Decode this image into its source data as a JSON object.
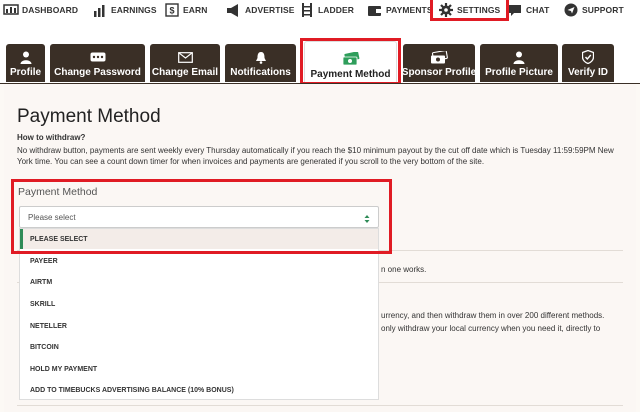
{
  "topnav": {
    "items": [
      {
        "label": "DASHBOARD",
        "icon": "dashboard-icon"
      },
      {
        "label": "EARNINGS",
        "icon": "bar-chart-icon"
      },
      {
        "label": "EARN",
        "icon": "dollar-icon"
      },
      {
        "label": "ADVERTISE",
        "icon": "megaphone-icon"
      },
      {
        "label": "LADDER",
        "icon": "ladder-icon"
      },
      {
        "label": "PAYMENTS",
        "icon": "wallet-icon"
      },
      {
        "label": "SETTINGS",
        "icon": "gear-icon"
      },
      {
        "label": "CHAT",
        "icon": "chat-icon"
      },
      {
        "label": "SUPPORT",
        "icon": "send-icon"
      }
    ]
  },
  "tabs": [
    {
      "label": "Profile",
      "icon": "user-icon"
    },
    {
      "label": "Change Password",
      "icon": "password-icon"
    },
    {
      "label": "Change Email",
      "icon": "envelope-icon"
    },
    {
      "label": "Notifications",
      "icon": "bell-icon"
    },
    {
      "label": "Payment Method",
      "icon": "money-icon",
      "active": true
    },
    {
      "label": "Sponsor Profile",
      "icon": "money-bill-icon"
    },
    {
      "label": "Profile Picture",
      "icon": "user-icon"
    },
    {
      "label": "Verify ID",
      "icon": "shield-check-icon"
    }
  ],
  "page": {
    "title": "Payment Method",
    "howto_heading": "How to withdraw?",
    "howto_text": "No withdraw button, payments are sent weekly every Thursday automatically if you reach the $10 minimum payout by the cut off date which is Tuesday 11:59:59PM New York time. You can see a count down timer for when invoices and payments are generated if you scroll to the very bottom of the site."
  },
  "form": {
    "label": "Payment Method",
    "selected": "Please select",
    "options": [
      "PLEASE SELECT",
      "PAYEER",
      "AIRTM",
      "SKRILL",
      "NETELLER",
      "BITCOIN",
      "HOLD MY PAYMENT",
      "ADD TO TIMEBUCKS ADVERTISING BALANCE (10% BONUS)"
    ]
  },
  "background_text": {
    "line1": "n one works.",
    "line2": "urrency, and then withdraw them in over 200 different methods.",
    "line3": "only withdraw your local currency when you need it, directly to"
  },
  "colors": {
    "tab_dark": "#3a2f26",
    "highlight_red": "#e01b24",
    "selected_green": "#2e8b57",
    "money_green": "#2e9e5b"
  }
}
